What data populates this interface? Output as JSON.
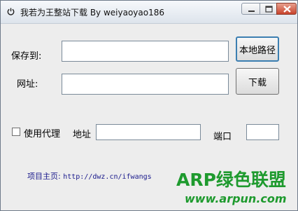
{
  "window": {
    "title": "我若为王整站下载    By weiyaoyao186"
  },
  "form": {
    "save_label": "保存到:",
    "save_value": "",
    "browse_button": "本地路径",
    "url_label": "网址:",
    "url_value": "",
    "download_button": "下载",
    "proxy_checkbox_label": "使用代理",
    "proxy_checked": false,
    "address_label": "地址",
    "address_value": "",
    "port_label": "端口",
    "port_value": ""
  },
  "footer": {
    "homepage_label": "项目主页:",
    "homepage_url": "http://dwz.cn/ifwangs"
  },
  "watermark": {
    "main": "ARP绿色联盟",
    "url": "www.arpun.com"
  },
  "colors": {
    "watermark": "#1e9a2e",
    "link": "#1a1a8c",
    "focus_border": "#3c7fb1"
  }
}
